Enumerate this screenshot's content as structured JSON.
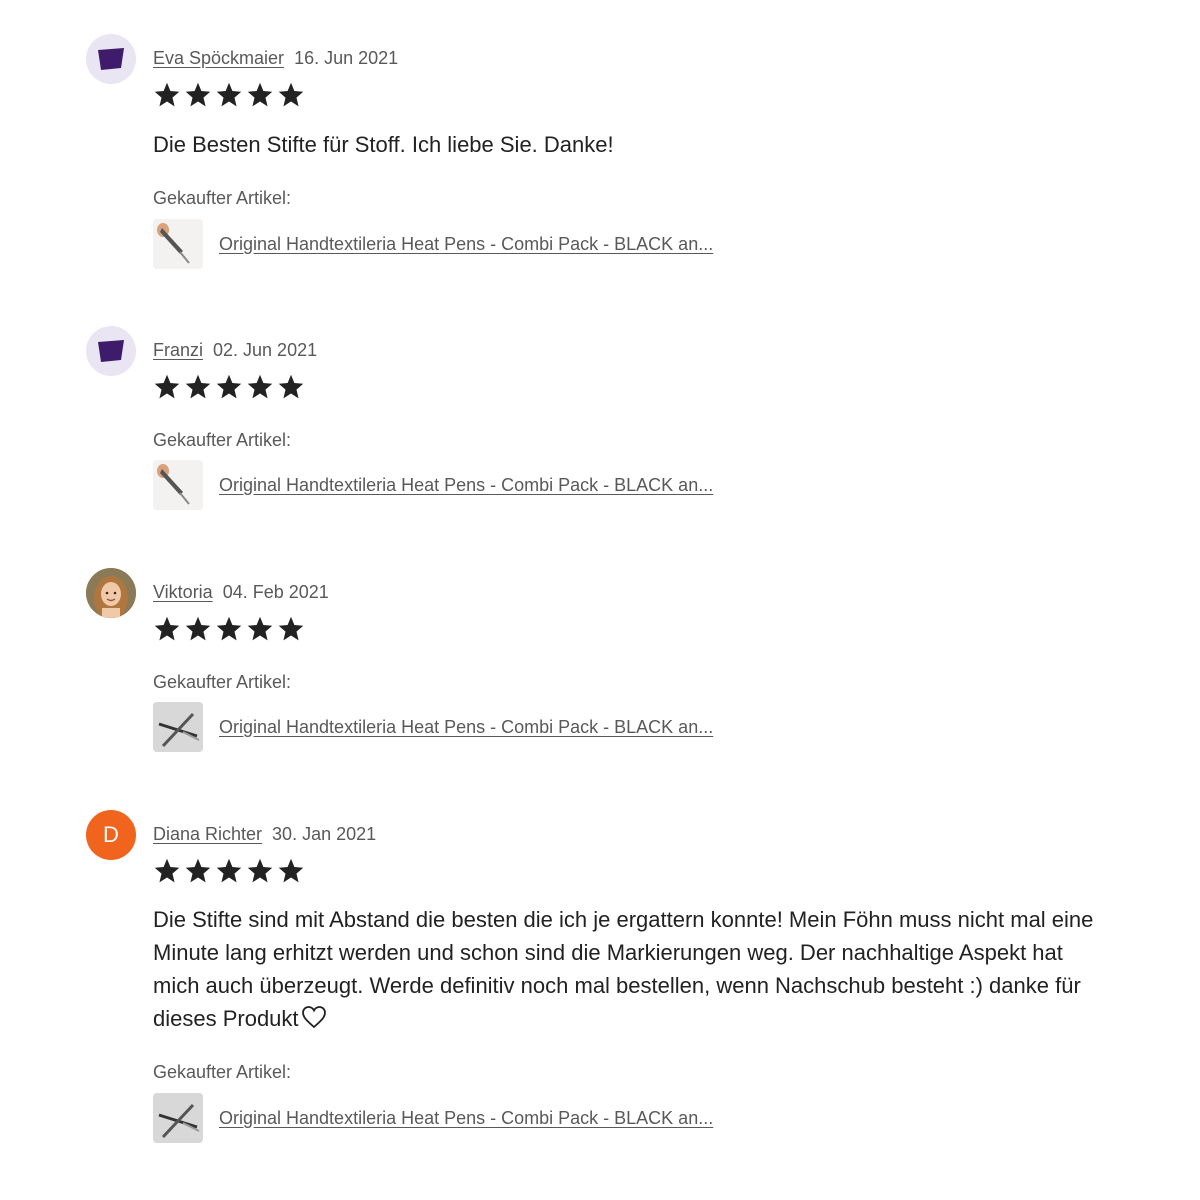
{
  "colors": {
    "star": "#222222",
    "avatar_purple_shape": "#3f1b6b",
    "avatar_initial_bg": "#f1641e",
    "muted_text": "#595959"
  },
  "purchased_label": "Gekaufter Artikel:",
  "reviews": [
    {
      "avatar": {
        "type": "shape",
        "icon": "purple-cup-avatar"
      },
      "name": "Eva Spöckmaier",
      "date": "16. Jun 2021",
      "rating": 5,
      "text": "Die Besten Stifte für Stoff. Ich liebe Sie. Danke!",
      "item": {
        "title": "Original Handtextileria Heat Pens - Combi Pack - BLACK an...",
        "thumb": "pen-tip-photo"
      }
    },
    {
      "avatar": {
        "type": "shape",
        "icon": "purple-cup-avatar"
      },
      "name": "Franzi",
      "date": "02. Jun 2021",
      "rating": 5,
      "text": "",
      "item": {
        "title": "Original Handtextileria Heat Pens - Combi Pack - BLACK an...",
        "thumb": "pen-tip-photo"
      }
    },
    {
      "avatar": {
        "type": "photo",
        "icon": "profile-photo"
      },
      "name": "Viktoria",
      "date": "04. Feb 2021",
      "rating": 5,
      "text": "",
      "item": {
        "title": "Original Handtextileria Heat Pens - Combi Pack - BLACK an...",
        "thumb": "crossed-pens-photo"
      }
    },
    {
      "avatar": {
        "type": "initial",
        "letter": "D"
      },
      "name": "Diana Richter",
      "date": "30. Jan 2021",
      "rating": 5,
      "text": "Die Stifte sind mit Abstand die besten die ich je ergattern konnte! Mein Föhn muss nicht mal eine Minute lang erhitzt werden und schon sind die Markierungen weg. Der nachhaltige Aspekt hat mich auch überzeugt. Werde definitiv noch mal bestellen, wenn Nachschub besteht :) danke für dieses Produkt",
      "text_icon": "heart-icon",
      "item": {
        "title": "Original Handtextileria Heat Pens - Combi Pack - BLACK an...",
        "thumb": "crossed-pens-photo"
      }
    }
  ]
}
